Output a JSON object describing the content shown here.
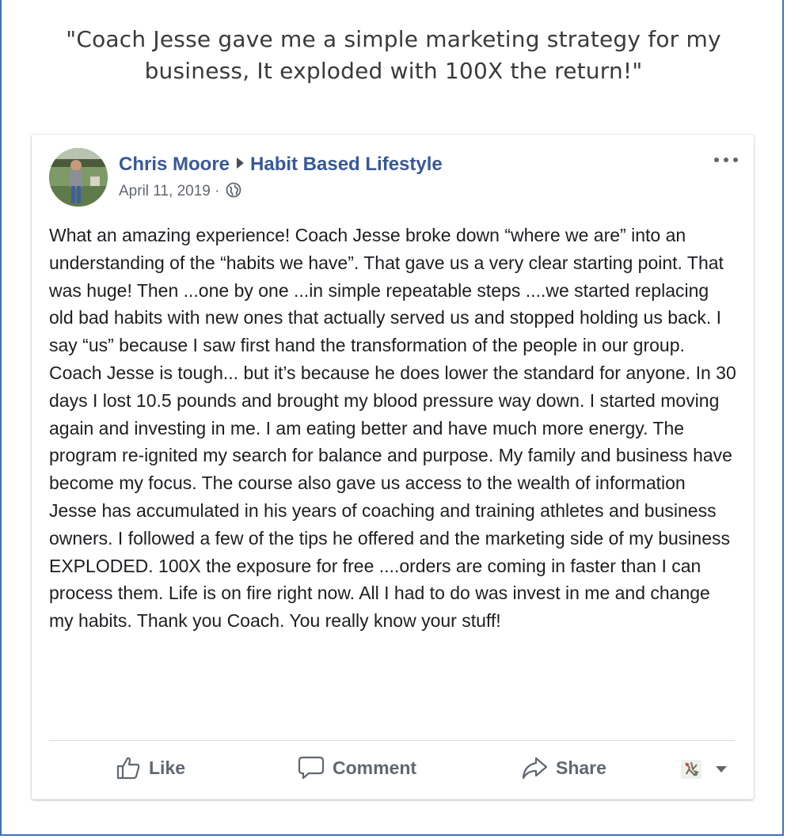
{
  "headline": "\"Coach  Jesse gave me a simple marketing strategy for my business, It exploded with 100X the return!\"",
  "post": {
    "author": "Chris Moore",
    "group": "Habit Based Lifestyle",
    "date": "April 11, 2019 ·",
    "privacy_icon": "globe-icon",
    "menu_icon": "more-options-icon",
    "body": "What an amazing experience! Coach Jesse broke down “where we are” into an understanding of the “habits we have”. That gave us a very clear starting point. That was huge! Then ...one by one ...in simple repeatable steps ....we started replacing old bad habits with new ones that actually served us and stopped holding us back. I say “us” because I saw first hand the transformation of the people in our group. Coach Jesse is tough... but it’s because he does lower the standard for anyone. In 30 days I lost 10.5 pounds and brought my blood pressure way down. I started moving again and investing in me. I am eating better and have much more energy. The program re-ignited my search for balance and purpose. My family and business have become my focus. The course also gave us access to the wealth of information Jesse has accumulated in his years of coaching and training athletes and business owners. I followed a few of the tips he offered and the marketing side of my business EXPLODED. 100X the exposure for free ....orders are coming in faster than I can process them. Life is on fire right now. All I had to do was invest in me and change my habits. Thank you Coach. You really know your stuff!"
  },
  "actions": {
    "like": "Like",
    "comment": "Comment",
    "share": "Share"
  },
  "colors": {
    "link_blue": "#385898",
    "frame_border": "#3f6fb8",
    "action_gray": "#606770",
    "body_text": "#1c1e21"
  }
}
